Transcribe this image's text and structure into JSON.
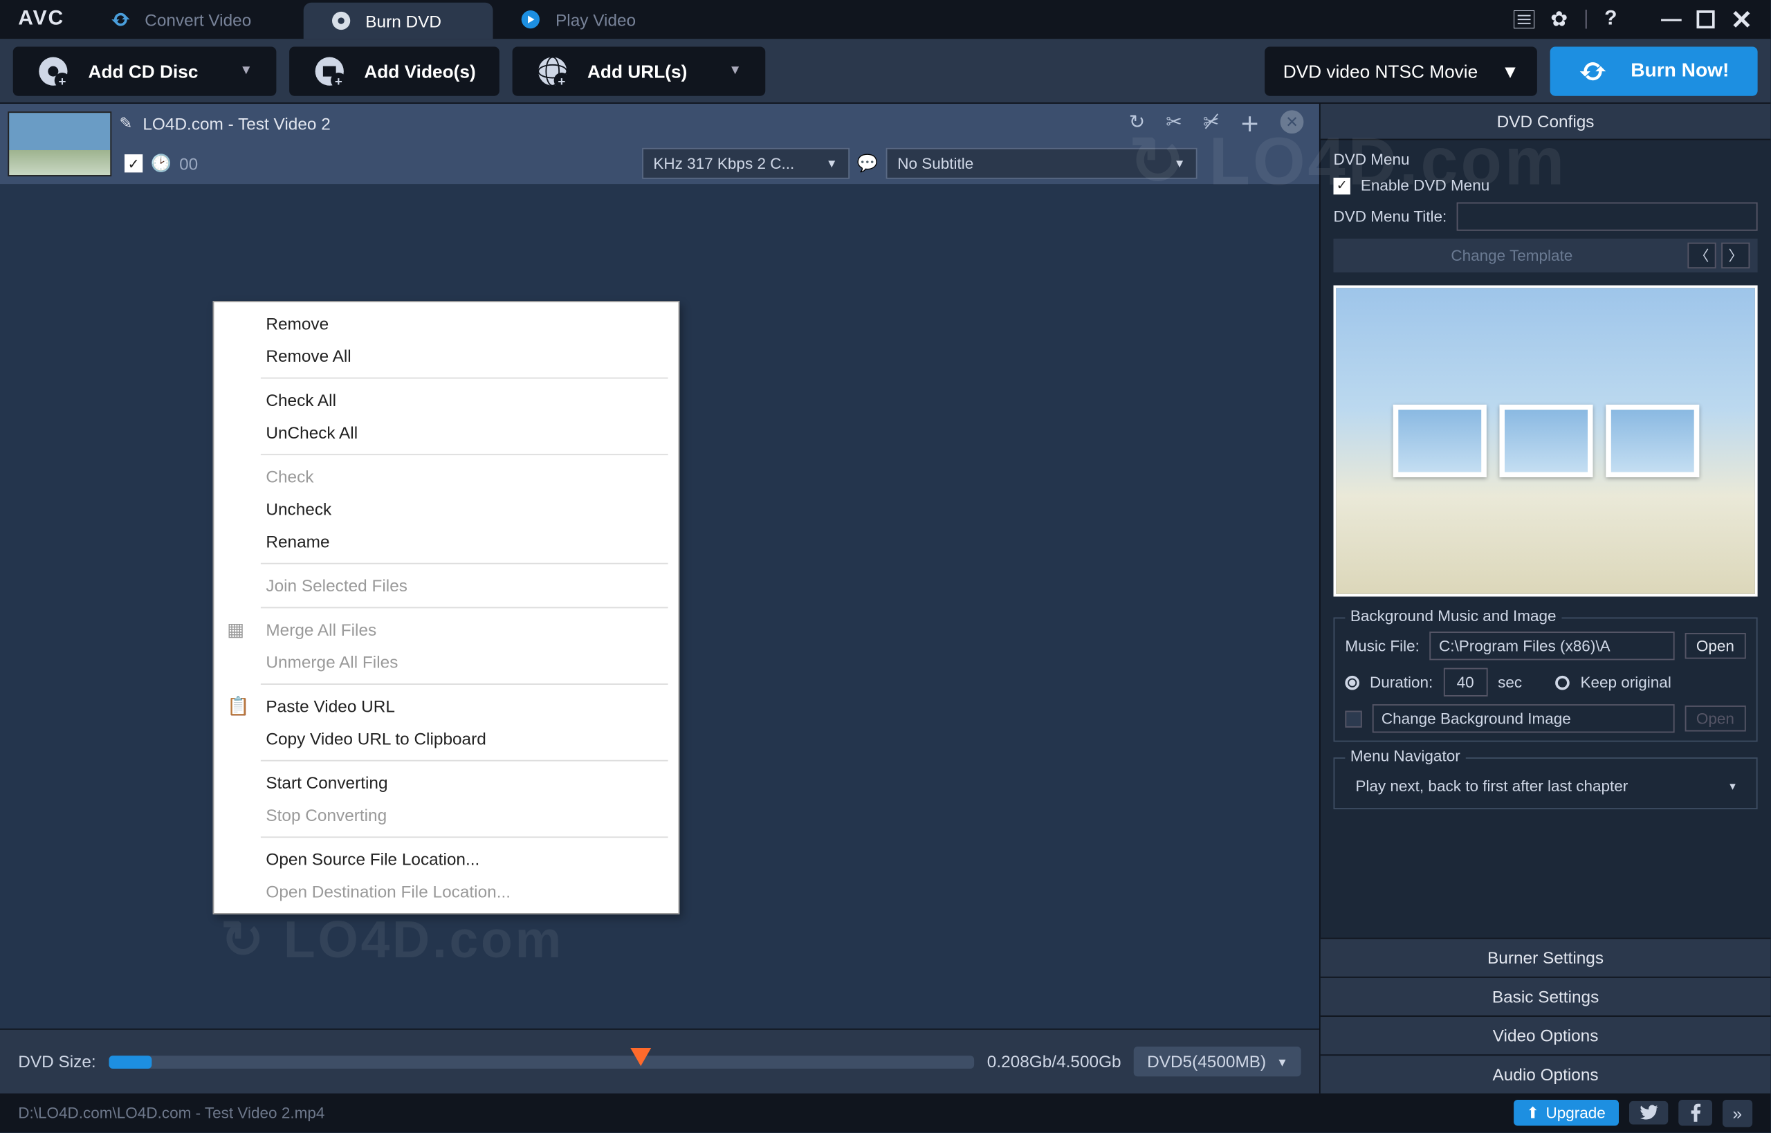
{
  "titlebar": {
    "logo": "AVC",
    "tabs": [
      {
        "label": "Convert Video"
      },
      {
        "label": "Burn DVD"
      },
      {
        "label": "Play Video"
      }
    ]
  },
  "toolbar": {
    "add_cd": "Add CD Disc",
    "add_videos": "Add Video(s)",
    "add_urls": "Add URL(s)",
    "profile": "DVD video NTSC Movie",
    "burn_now": "Burn Now!"
  },
  "video": {
    "title": "LO4D.com - Test Video 2",
    "duration_fragment": "00",
    "audio_sel": "KHz 317 Kbps 2 C...",
    "subtitle_sel": "No Subtitle"
  },
  "context_menu": {
    "items": [
      {
        "label": "Remove",
        "enabled": true
      },
      {
        "label": "Remove All",
        "enabled": true
      },
      {
        "sep": true
      },
      {
        "label": "Check All",
        "enabled": true
      },
      {
        "label": "UnCheck All",
        "enabled": true
      },
      {
        "sep": true
      },
      {
        "label": "Check",
        "enabled": false
      },
      {
        "label": "Uncheck",
        "enabled": true
      },
      {
        "label": "Rename",
        "enabled": true
      },
      {
        "sep": true
      },
      {
        "label": "Join Selected Files",
        "enabled": false
      },
      {
        "sep": true
      },
      {
        "label": "Merge All Files",
        "enabled": false,
        "icon": "merge"
      },
      {
        "label": "Unmerge All Files",
        "enabled": false
      },
      {
        "sep": true
      },
      {
        "label": "Paste Video URL",
        "enabled": true,
        "icon": "paste"
      },
      {
        "label": "Copy Video URL to Clipboard",
        "enabled": true
      },
      {
        "sep": true
      },
      {
        "label": "Start Converting",
        "enabled": true
      },
      {
        "label": "Stop Converting",
        "enabled": false
      },
      {
        "sep": true
      },
      {
        "label": "Open Source File Location...",
        "enabled": true
      },
      {
        "label": "Open Destination File Location...",
        "enabled": false
      }
    ]
  },
  "dvdsize": {
    "label": "DVD Size:",
    "text": "0.208Gb/4.500Gb",
    "select": "DVD5(4500MB)"
  },
  "status": {
    "path": "D:\\LO4D.com\\LO4D.com - Test Video 2.mp4",
    "upgrade": "Upgrade",
    "more": "»"
  },
  "right": {
    "header": "DVD Configs",
    "dvd_menu_section": "DVD Menu",
    "enable_menu": "Enable DVD Menu",
    "menu_title_label": "DVD Menu Title:",
    "menu_title_value": "",
    "change_template": "Change Template",
    "bg_section": "Background Music and Image",
    "music_file_label": "Music File:",
    "music_file_value": "C:\\Program Files (x86)\\A",
    "open": "Open",
    "duration_label": "Duration:",
    "duration_value": "40",
    "duration_unit": "sec",
    "keep_original": "Keep original",
    "change_bg": "Change Background Image",
    "nav_section": "Menu Navigator",
    "nav_value": "Play next, back to first after last chapter",
    "tabs": [
      "Burner Settings",
      "Basic Settings",
      "Video Options",
      "Audio Options"
    ]
  }
}
